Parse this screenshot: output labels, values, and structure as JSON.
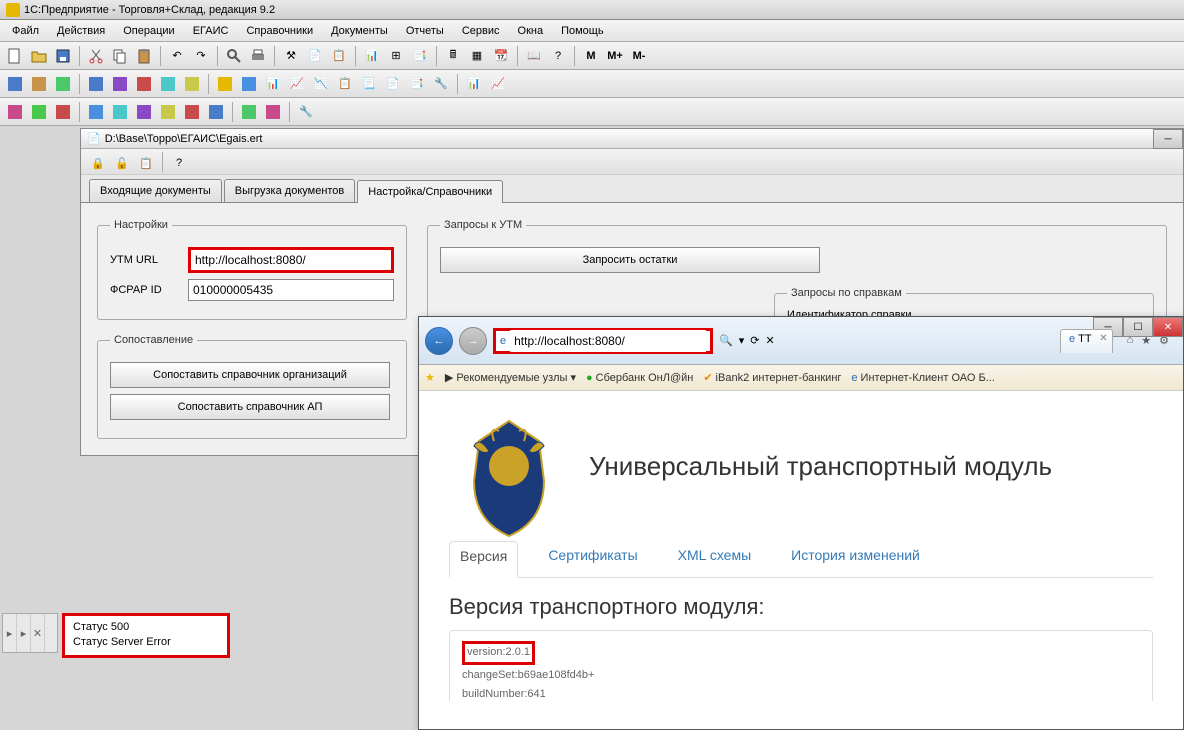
{
  "app": {
    "title": "1С:Предприятие - Торговля+Склад, редакция 9.2"
  },
  "menu": [
    "Файл",
    "Действия",
    "Операции",
    "ЕГАИС",
    "Справочники",
    "Документы",
    "Отчеты",
    "Сервис",
    "Окна",
    "Помощь"
  ],
  "toolbar_m": [
    "M",
    "M+",
    "M-"
  ],
  "doc": {
    "path": "D:\\Base\\Торро\\ЕГАИС\\Egais.ert"
  },
  "tabs": {
    "t1": "Входящие документы",
    "t2": "Выгрузка документов",
    "t3": "Настройка/Справочники"
  },
  "settings": {
    "legend": "Настройки",
    "utm_label": "УТМ URL",
    "utm_value": "http://localhost:8080/",
    "fsrar_label": "ФСРАР ID",
    "fsrar_value": "010000005435"
  },
  "compare": {
    "legend": "Сопоставление",
    "btn1": "Сопоставить справочник организаций",
    "btn2": "Сопоставить справочник АП"
  },
  "requests": {
    "legend": "Запросы к УТМ",
    "btn1": "Запросить остатки",
    "sub_legend": "Запросы по справкам",
    "sub_label": "Идентификатор справки"
  },
  "status": {
    "l1": "Статус 500",
    "l2": "Статус Server Error"
  },
  "ie": {
    "url": "http://localhost:8080/",
    "tab": "ТТ",
    "fav_label": "Рекомендуемые узлы",
    "fav1": "Сбербанк ОнЛ@йн",
    "fav2": "iBank2  интернет-банкинг",
    "fav3": "Интернет-Клиент ОАО Б...",
    "utm_title": "Универсальный транспортный модуль",
    "nav": {
      "version": "Версия",
      "certs": "Сертификаты",
      "xml": "XML схемы",
      "history": "История изменений"
    },
    "section_title": "Версия транспортного модуля:",
    "ver_line": "version:2.0.1",
    "changeset": "changeSet:b69ae108fd4b+",
    "build": "buildNumber:641"
  }
}
